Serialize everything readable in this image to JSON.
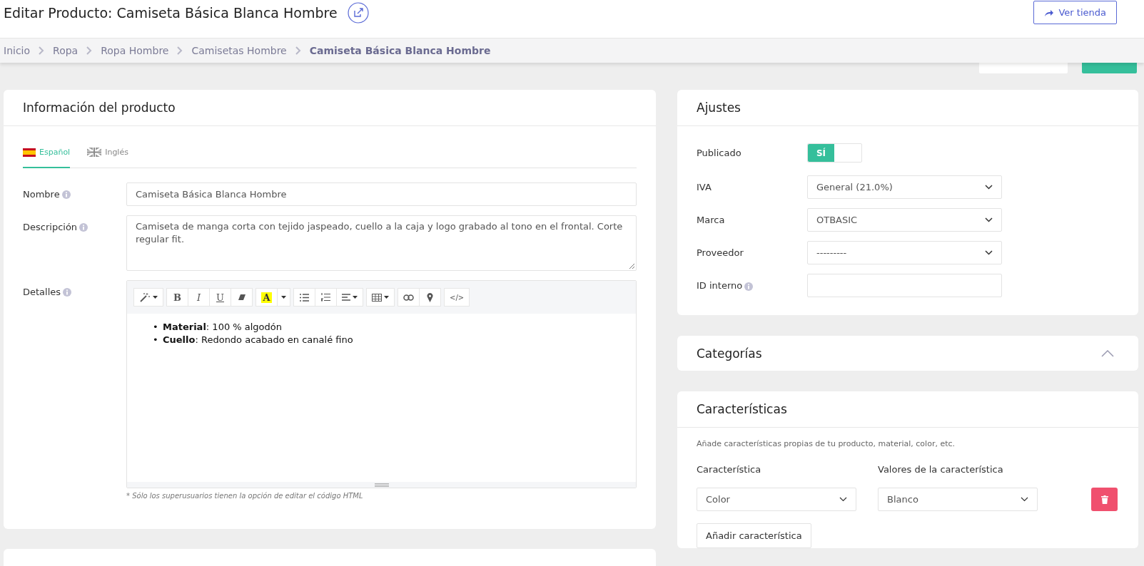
{
  "header": {
    "title": "Editar Producto: Camiseta Básica Blanca Hombre",
    "store_button": "Ver tienda"
  },
  "breadcrumb": [
    {
      "label": "Inicio",
      "current": false
    },
    {
      "label": "Ropa",
      "current": false
    },
    {
      "label": "Ropa Hombre",
      "current": false
    },
    {
      "label": "Camisetas Hombre",
      "current": false
    },
    {
      "label": "Camiseta Básica Blanca Hombre",
      "current": true
    }
  ],
  "hidden_buttons": [
    {
      "kind": "secondary"
    },
    {
      "kind": "primary"
    }
  ],
  "product_info": {
    "title": "Información del producto",
    "language_tabs": [
      {
        "label": "Español",
        "kind": "es",
        "selected": true
      },
      {
        "label": "Inglés",
        "kind": "gb",
        "selected": false
      }
    ],
    "name": {
      "label": "Nombre",
      "info": true,
      "value": "Camiseta Básica Blanca Hombre"
    },
    "description": {
      "label": "Descripción",
      "info": true,
      "value": "Camiseta de manga corta con tejido jaspeado, cuello a la caja y logo grabado al tono en el frontal. Corte regular fit."
    },
    "details": {
      "label": "Detalles",
      "info": true,
      "toolbar": [
        [
          {
            "kind": "magic",
            "caret": true
          }
        ],
        [
          {
            "kind": "bold",
            "label": "B"
          },
          {
            "kind": "italic",
            "label": "I"
          },
          {
            "kind": "underline",
            "label": "U"
          },
          {
            "kind": "eraser"
          }
        ],
        [
          {
            "kind": "color",
            "label": "A"
          },
          {
            "kind": "caret"
          }
        ],
        [
          {
            "kind": "bullets"
          },
          {
            "kind": "numbers"
          },
          {
            "kind": "align",
            "caret": true
          }
        ],
        [
          {
            "kind": "table",
            "caret": true
          }
        ],
        [
          {
            "kind": "link"
          },
          {
            "kind": "pin"
          }
        ],
        [
          {
            "kind": "code",
            "label": "</>"
          }
        ]
      ],
      "items": [
        {
          "marker": "•",
          "text": "**Material**: 100 % algodón"
        },
        {
          "marker": "•",
          "text": "**Cuello**: Redondo acabado en canalé fino"
        }
      ],
      "note": "* Sólo los superusuarios tienen la opción de editar el código HTML"
    }
  },
  "settings": {
    "title": "Ajustes",
    "published": {
      "label": "Publicado",
      "on": true,
      "on_label": "SÍ"
    },
    "selects": [
      {
        "label": "IVA",
        "value": "General (21.0%)"
      },
      {
        "label": "Marca",
        "value": "OTBASIC"
      },
      {
        "label": "Proveedor",
        "value": "---------"
      }
    ],
    "internal_id": {
      "label": "ID interno",
      "info": true
    }
  },
  "categories": {
    "title": "Categorías",
    "expanded": false
  },
  "features": {
    "title": "Características",
    "hint": "Añade características propias de tu producto, material, color, etc.",
    "column_1": "Característica",
    "column_2": "Valores de la característica",
    "rows": [
      {
        "feature": "Color",
        "value": "Blanco"
      }
    ],
    "add_button": "Añadir característica"
  }
}
